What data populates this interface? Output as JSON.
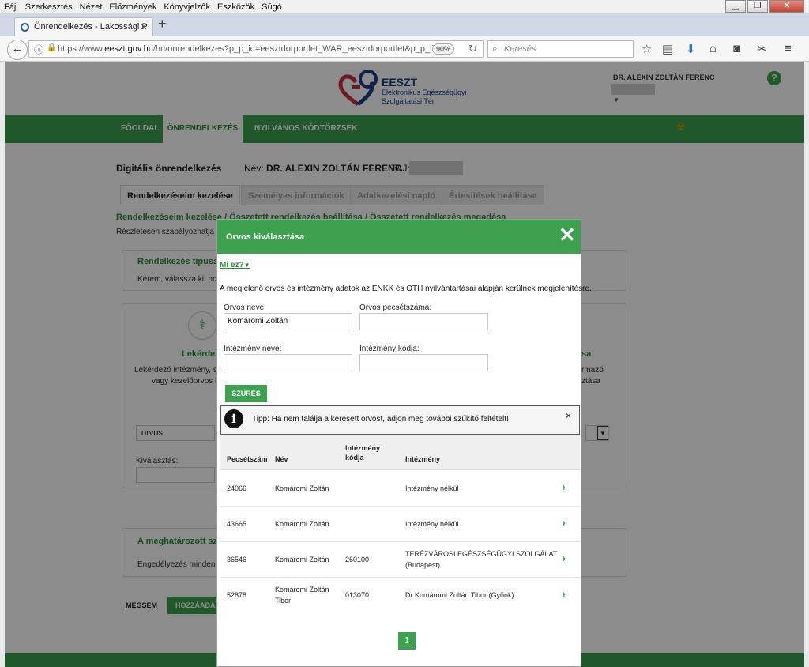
{
  "browser": {
    "menu": [
      "Fájl",
      "Szerkesztés",
      "Nézet",
      "Előzmények",
      "Könyvjelzők",
      "Eszközök",
      "Súgó"
    ],
    "tab_title": "Önrendelkezés - Lakossági P",
    "url_prefix": "https://www.",
    "url_domain": "eeszt.gov.hu",
    "url_rest": "/hu/onrendelkezes?p_p_id=eesztdorportlet_WAR_eesztdorportlet&p_p_lifecyc",
    "zoom": "90%",
    "search_placeholder": "Keresés"
  },
  "site": {
    "logo_name": "EESZT",
    "logo_sub": "Elektronikus Egészségügyi Szolgáltatási Tér",
    "user_name": "DR. ALEXIN ZOLTÁN FERENC",
    "help": "?",
    "nav": [
      "FŐOLDAL",
      "ÖNRENDELKEZÉS",
      "NYILVÁNOS KÓDTÖRZSEK"
    ],
    "page_title": "Digitális önrendelkezés",
    "nev_label": "Név:",
    "nev_value": "DR. ALEXIN ZOLTÁN FERENC",
    "taj_label": "TAJ:",
    "tabs": [
      "Rendelkezéseim kezelése",
      "Személyes információk",
      "Adatkezelési napló",
      "Értesítések beállítása"
    ],
    "breadcrumb": "Rendelkezéseim kezelése / Összetett rendelkezés beállítása / Összetett rendelkezés megadása",
    "detail": "Részletesen szabályozhatja e",
    "bg_type_title": "Rendelkezés típusa",
    "bg_type_text": "Kérem, válassza ki, hog",
    "bg_lekerdezo": "Lekérdez",
    "bg_lekerdezo_text1": "Lekérdező intézmény, sz",
    "bg_lekerdezo_text2": "vagy kezelőorvos k",
    "bg_right_title": "sa",
    "bg_right_text1": "rmazó",
    "bg_right_text2": "ztása",
    "bg_select_value": "orvos",
    "bg_kivalasztas": "Kiválasztás:",
    "bg_meghat": "A meghatározott sz",
    "bg_engedely": "Engedélyezés minden lel",
    "megsem": "MÉGSEM",
    "hozzaadas": "HOZZÁADÁS"
  },
  "modal": {
    "title": "Orvos kiválasztása",
    "close": "✕",
    "mi_ez": "Mi ez?",
    "info": "A megjelenő orvos és intézmény adatok az ENKK és OTH nyilvántartásai alapján kerülnek megjelenítésre.",
    "fields": {
      "orvos_neve_label": "Orvos neve:",
      "orvos_neve_value": "Komáromi Zoltán",
      "pecsetszam_label": "Orvos pecsétszáma:",
      "pecsetszam_value": "",
      "intezmeny_neve_label": "Intézmény neve:",
      "intezmeny_neve_value": "",
      "intezmeny_kodja_label": "Intézmény kódja:",
      "intezmeny_kodja_value": ""
    },
    "szures": "SZŰRÉS",
    "tip": "Tipp: Ha nem találja a keresett orvost, adjon meg további szűkítő feltételt!",
    "tip_close": "×",
    "columns": {
      "pecsetszam": "Pecsétszám",
      "nev": "Név",
      "intezmeny_kodja_1": "Intézmény",
      "intezmeny_kodja_2": "kódja",
      "intezmeny": "Intézmény"
    },
    "rows": [
      {
        "pecsetszam": "24066",
        "nev1": "Komáromi Zoltán",
        "nev2": "",
        "kod": "",
        "intezmeny1": "Intézmény nélkül",
        "intezmeny2": ""
      },
      {
        "pecsetszam": "43665",
        "nev1": "Komáromi Zoltán",
        "nev2": "",
        "kod": "",
        "intezmeny1": "Intézmény nélkül",
        "intezmeny2": ""
      },
      {
        "pecsetszam": "36546",
        "nev1": "Komáromi Zoltán",
        "nev2": "",
        "kod": "260100",
        "intezmeny1": "TERÉZVÁROSI EGÉSZSÉGÜGYI SZOLGÁLAT",
        "intezmeny2": "(Budapest)"
      },
      {
        "pecsetszam": "52878",
        "nev1": "Komáromi Zoltán",
        "nev2": "Tibor",
        "kod": "013070",
        "intezmeny1": "Dr Komáromi Zoltán Tibor (Gyönk)",
        "intezmeny2": ""
      }
    ],
    "page": "1"
  }
}
